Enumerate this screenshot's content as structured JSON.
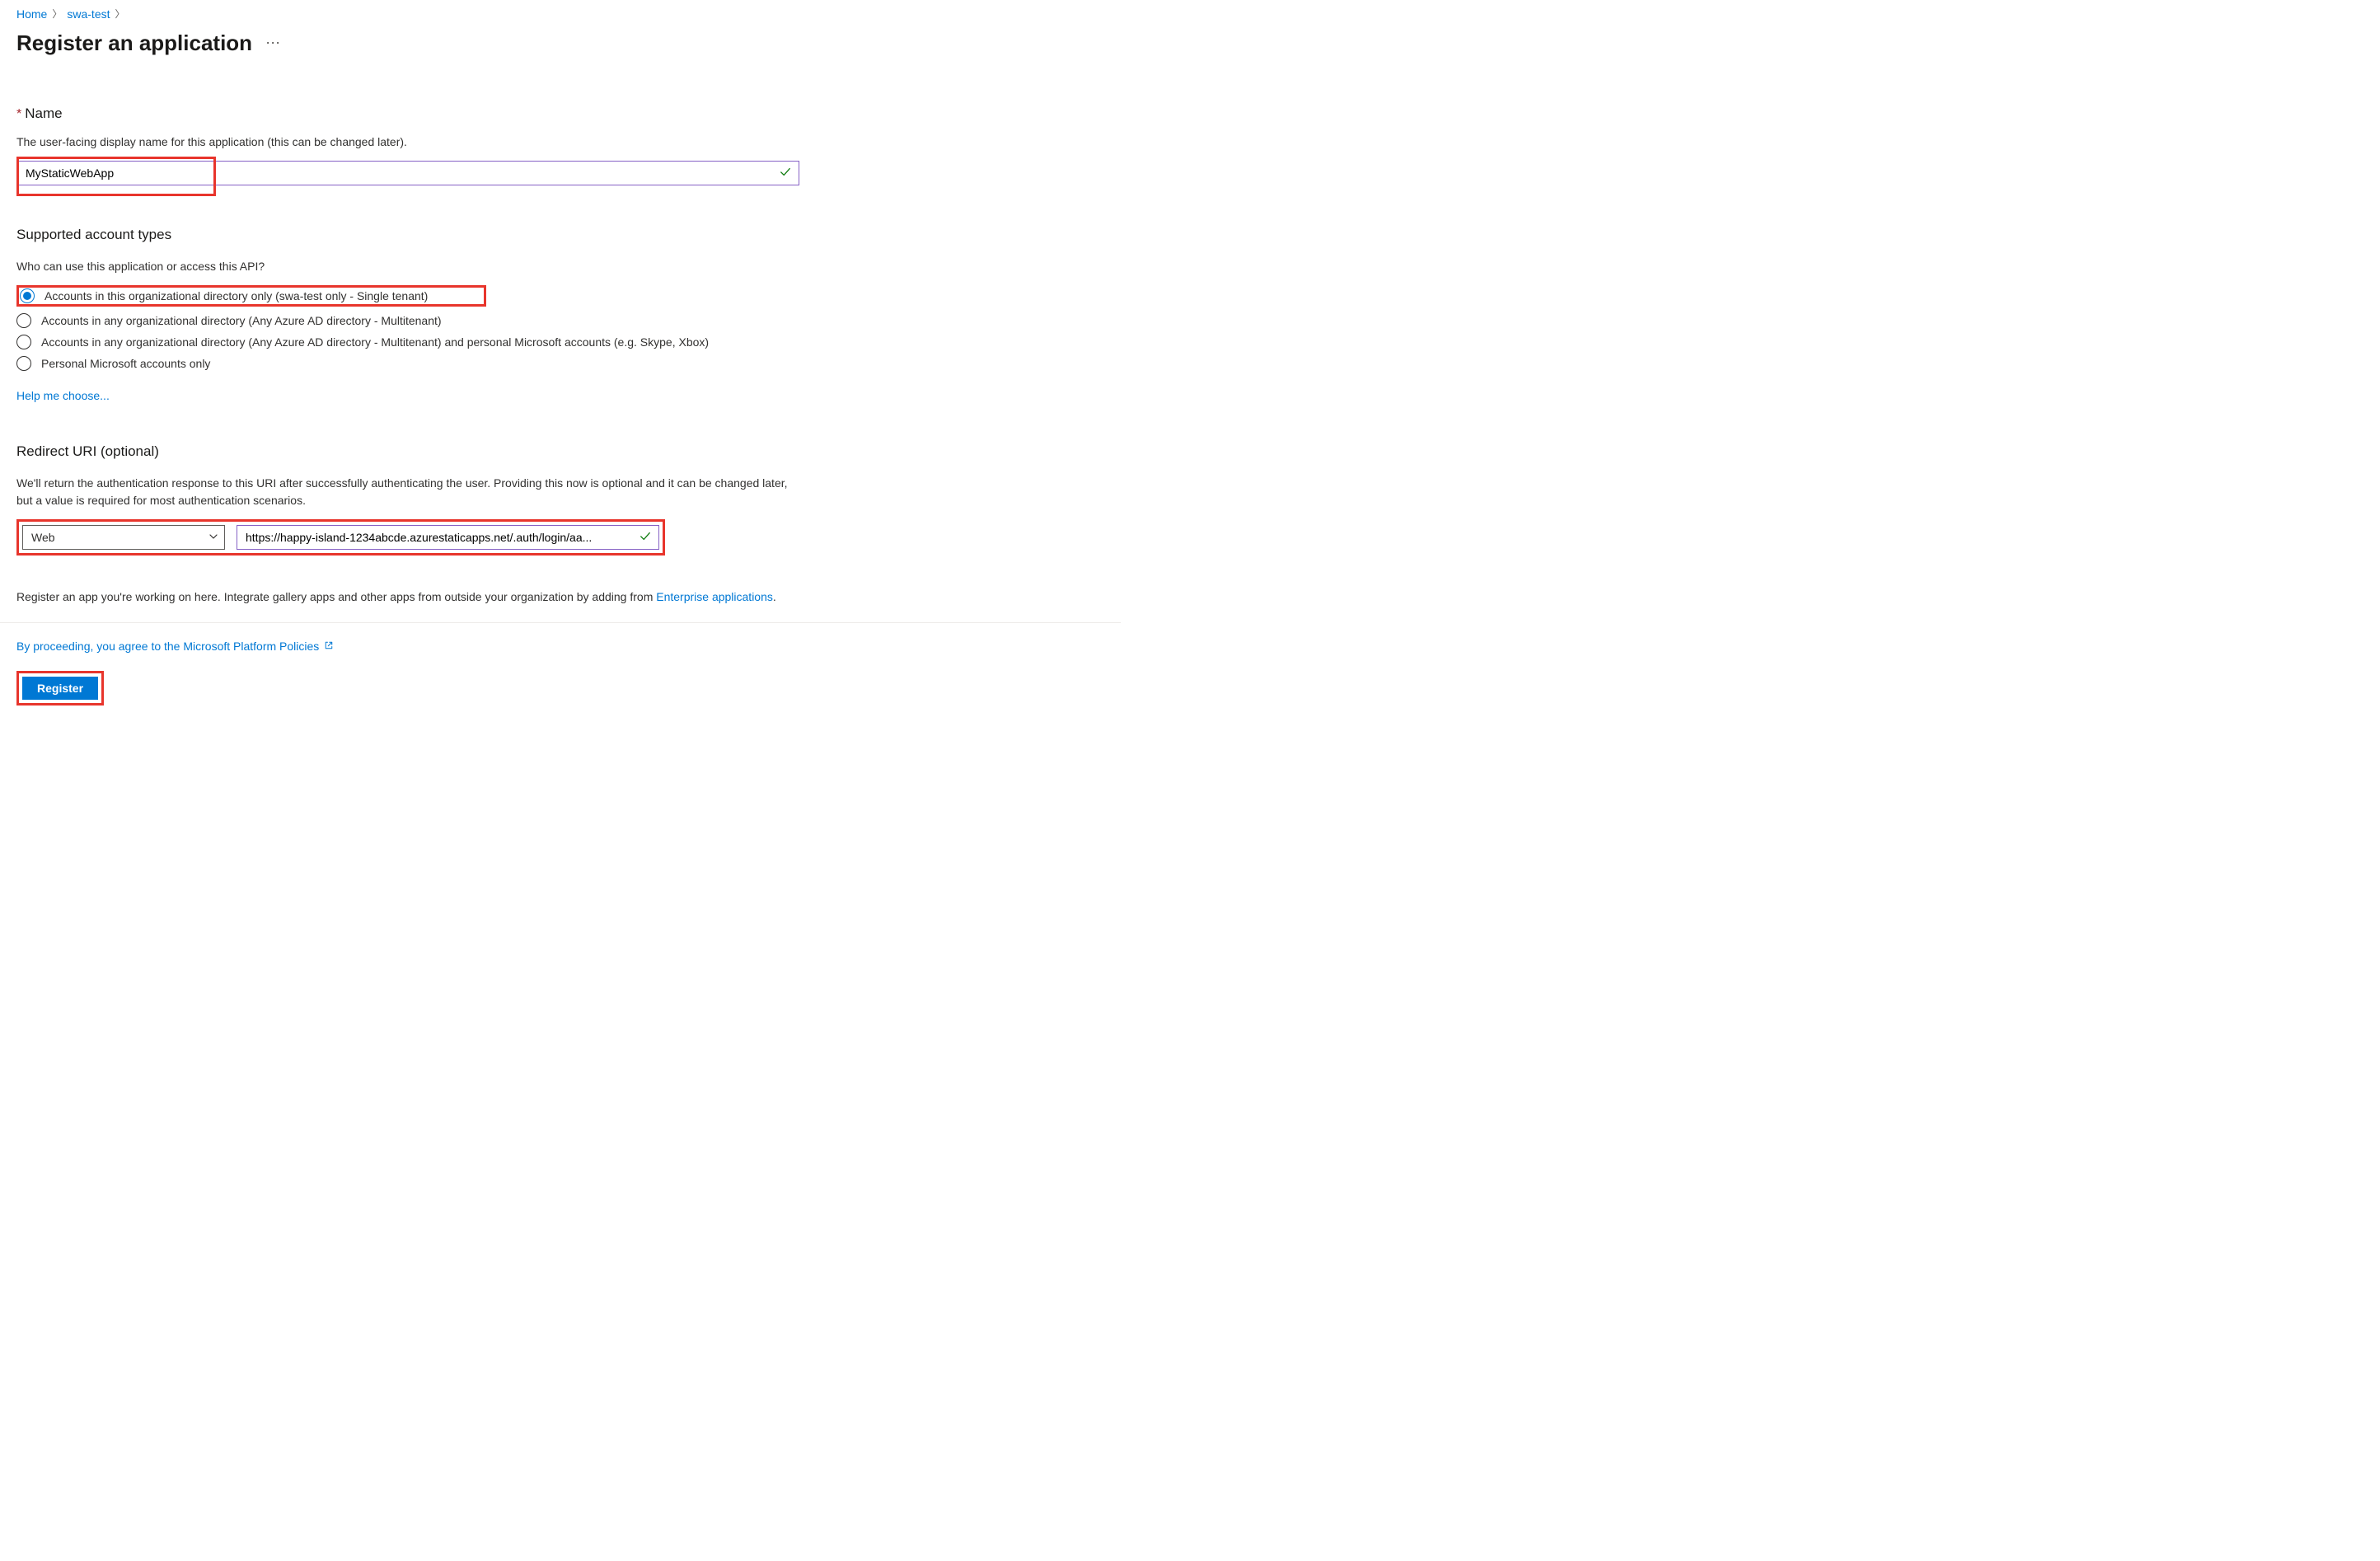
{
  "breadcrumb": {
    "home": "Home",
    "tenant": "swa-test"
  },
  "title": "Register an application",
  "name": {
    "label": "Name",
    "helper": "The user-facing display name for this application (this can be changed later).",
    "value": "MyStaticWebApp"
  },
  "account_types": {
    "header": "Supported account types",
    "helper": "Who can use this application or access this API?",
    "options": [
      "Accounts in this organizational directory only (swa-test only - Single tenant)",
      "Accounts in any organizational directory (Any Azure AD directory - Multitenant)",
      "Accounts in any organizational directory (Any Azure AD directory - Multitenant) and personal Microsoft accounts (e.g. Skype, Xbox)",
      "Personal Microsoft accounts only"
    ],
    "help_link": "Help me choose..."
  },
  "redirect": {
    "header": "Redirect URI (optional)",
    "helper": "We'll return the authentication response to this URI after successfully authenticating the user. Providing this now is optional and it can be changed later, but a value is required for most authentication scenarios.",
    "platform": "Web",
    "uri": "https://happy-island-1234abcde.azurestaticapps.net/.auth/login/aa..."
  },
  "bottom": {
    "text_prefix": "Register an app you're working on here. Integrate gallery apps and other apps from outside your organization by adding from ",
    "link_text": "Enterprise applications",
    "text_suffix": "."
  },
  "footer": {
    "policies": "By proceeding, you agree to the Microsoft Platform Policies",
    "register": "Register"
  }
}
